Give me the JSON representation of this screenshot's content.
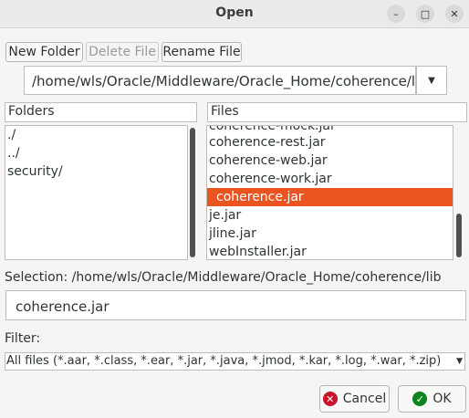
{
  "window": {
    "title": "Open",
    "minimize_icon": "minimize-icon",
    "maximize_icon": "maximize-icon",
    "close_icon": "close-icon"
  },
  "toolbar": {
    "new_folder": "New Folder",
    "delete_file": "Delete File",
    "rename_file": "Rename File"
  },
  "path": {
    "value": "/home/wls/Oracle/Middleware/Oracle_Home/coherence/lib",
    "dropdown_icon": "chevron-down-icon"
  },
  "folders": {
    "header": "Folders",
    "items": [
      "./",
      "../",
      "security/"
    ]
  },
  "files": {
    "header": "Files",
    "items": [
      "coherence-mock.jar",
      "coherence-rest.jar",
      "coherence-web.jar",
      "coherence-work.jar",
      "coherence.jar",
      "je.jar",
      "jline.jar",
      "webInstaller.jar"
    ],
    "selected": "coherence.jar"
  },
  "selection": {
    "label": "Selection: /home/wls/Oracle/Middleware/Oracle_Home/coherence/lib",
    "value": "coherence.jar"
  },
  "filter": {
    "label": "Filter:",
    "value": "All files (*.aar, *.class, *.ear, *.jar, *.java, *.jmod, *.kar, *.log, *.war, *.zip)"
  },
  "buttons": {
    "cancel": "Cancel",
    "ok": "OK"
  },
  "colors": {
    "accent": "#e95420",
    "cancel_icon": "#c7162b",
    "ok_icon": "#0e8420"
  }
}
